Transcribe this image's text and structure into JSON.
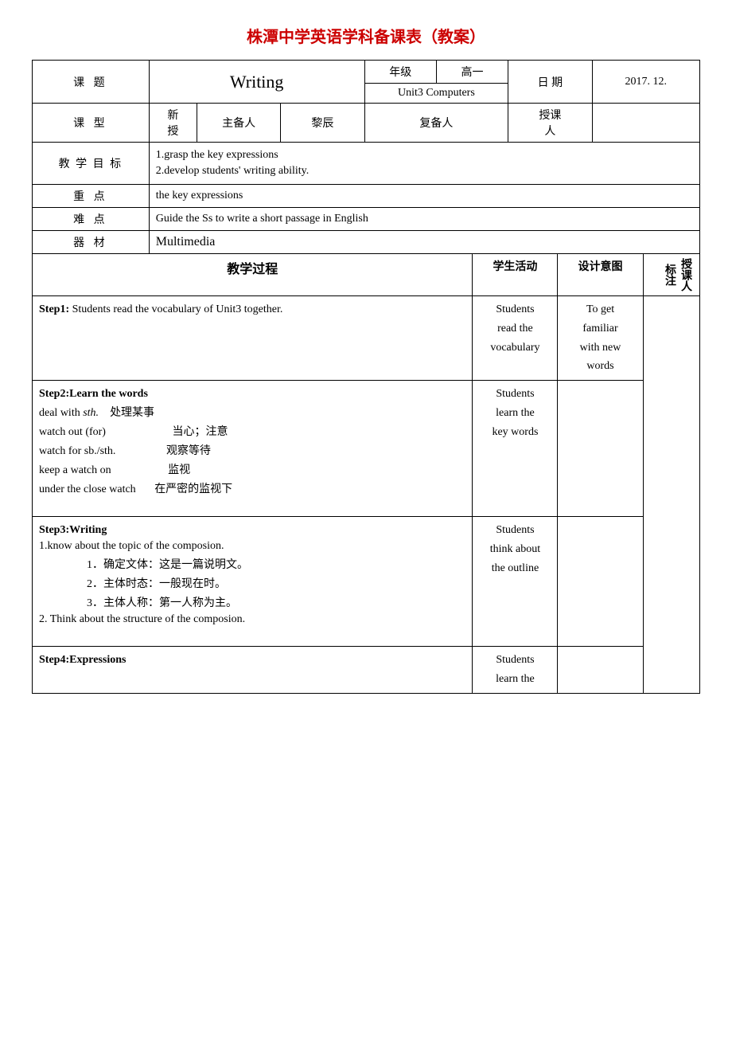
{
  "title": "株潭中学英语学科备课表（教案）",
  "header": {
    "writing_label": "Writing",
    "nianji_label": "年级",
    "nianji_value": "高一",
    "unit_label": "Unit3 Computers",
    "riqi_label": "日 期",
    "date_value": "2017. 12.",
    "keti_label": "课 题",
    "kexing_label": "课 型",
    "xinshuo_label": "新\n授",
    "zhubeiren_label": "主备人",
    "zhubeiren_value": "黎辰",
    "fubeiren_label": "复备人",
    "shoukeiren_label": "授课\n人"
  },
  "table_rows": [
    {
      "label": "教 学 目 标",
      "content": [
        "1.grasp the key expressions",
        "2.develop students' writing ability."
      ]
    },
    {
      "label": "重 点",
      "content": [
        "the key expressions"
      ]
    },
    {
      "label": "难 点",
      "content": [
        "Guide the Ss to write a short passage in English"
      ]
    },
    {
      "label": "器 材",
      "content": [
        "Multimedia"
      ]
    }
  ],
  "process_header": {
    "process_label": "教学过程",
    "student_activity_label": "学生活动",
    "design_label": "设计意图",
    "instructor_label": "授课人\n标注"
  },
  "steps": [
    {
      "id": "step1",
      "title": "Step1:",
      "title_rest": " Students read the vocabulary of Unit3 together.",
      "content": [],
      "student_activity": "Students\nread the\nvocabulary",
      "design": "To get\nfamiliar\nwith new\nwords"
    },
    {
      "id": "step2",
      "title": "Step2:",
      "title_rest": "Learn the words",
      "content": [
        {
          "text": "deal with sth.    处理某事",
          "indent": 0
        },
        {
          "text": "watch out (for)              当心；注意",
          "indent": 0
        },
        {
          "text": "watch for sb./sth.              观察等待",
          "indent": 0
        },
        {
          "text": "keep a watch on              监视",
          "indent": 0
        },
        {
          "text": "under the close watch    在严密的监视下",
          "indent": 0
        }
      ],
      "student_activity": "Students\nlearn the\nkey words",
      "design": ""
    },
    {
      "id": "step3",
      "title": "Step3:",
      "title_rest": "Writing",
      "content": [
        {
          "text": "1.know about the topic of the composion.",
          "indent": 0
        },
        {
          "text": "1．确定文体：这是一篇说明文。",
          "indent": 1
        },
        {
          "text": "2．主体时态：一般现在时。",
          "indent": 1
        },
        {
          "text": "3．主体人称：第一人称为主。",
          "indent": 1
        },
        {
          "text": "2. Think about the structure of the composion.",
          "indent": 0
        }
      ],
      "student_activity": "Students\nthink about\nthe outline",
      "design": ""
    },
    {
      "id": "step4",
      "title": "Step4:",
      "title_rest": "Expressions",
      "content": [],
      "student_activity": "Students\nlearn the",
      "design": ""
    }
  ]
}
